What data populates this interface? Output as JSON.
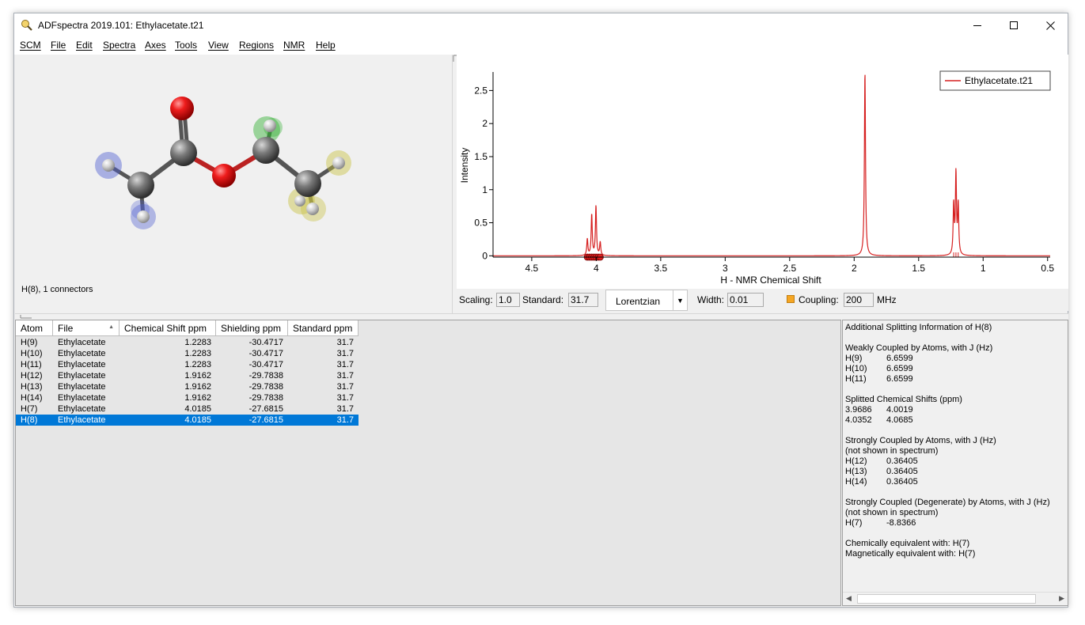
{
  "window": {
    "title": "ADFspectra 2019.101: Ethylacetate.t21"
  },
  "menu": [
    "SCM",
    "File",
    "Edit",
    "Spectra",
    "Axes",
    "Tools",
    "View",
    "Regions",
    "NMR",
    "Help"
  ],
  "molecule": {
    "status": "H(8), 1 connectors"
  },
  "spectrum": {
    "xlabel": "H - NMR Chemical Shift",
    "ylabel": "Intensity",
    "legend": "Ethylacetate.t21",
    "xticks": [
      "4.5",
      "4",
      "3.5",
      "3",
      "2.5",
      "2",
      "1.5",
      "1",
      "0.5"
    ],
    "yticks": [
      "0",
      "0.5",
      "1",
      "1.5",
      "2",
      "2.5"
    ]
  },
  "chart_data": {
    "type": "line",
    "xlabel": "H - NMR Chemical Shift",
    "ylabel": "Intensity",
    "xlim": [
      4.8,
      0.48
    ],
    "ylim": [
      -0.02,
      2.78
    ],
    "x_reversed": true,
    "series": [
      {
        "name": "Ethylacetate.t21",
        "color": "#d62020"
      }
    ],
    "peaks": [
      {
        "x": 4.069,
        "height": 0.25
      },
      {
        "x": 4.035,
        "height": 0.62
      },
      {
        "x": 4.002,
        "height": 0.75
      },
      {
        "x": 3.969,
        "height": 0.2
      },
      {
        "x": 1.9162,
        "height": 2.78
      },
      {
        "x": 1.2283,
        "height": 0.75
      },
      {
        "x": 1.2107,
        "height": 1.22
      },
      {
        "x": 1.1931,
        "height": 0.75
      }
    ],
    "linewidth": 0.01,
    "markers_x": [
      4.069,
      4.052,
      4.035,
      4.018,
      4.002,
      3.985,
      3.969
    ],
    "sticks_x": [
      1.2283,
      1.2107,
      1.1931
    ]
  },
  "toolbar": {
    "scaling_label": "Scaling:",
    "scaling_value": "1.0",
    "standard_label": "Standard:",
    "standard_value": "31.7",
    "lineshape": "Lorentzian",
    "width_label": "Width:",
    "width_value": "0.01",
    "coupling_label": "Coupling:",
    "coupling_value": "200",
    "unit": "MHz"
  },
  "table": {
    "columns": [
      "Atom",
      "File",
      "Chemical Shift ppm",
      "Shielding ppm",
      "Standard ppm"
    ],
    "rows": [
      [
        "H(9)",
        "Ethylacetate",
        "1.2283",
        "-30.4717",
        "31.7"
      ],
      [
        "H(10)",
        "Ethylacetate",
        "1.2283",
        "-30.4717",
        "31.7"
      ],
      [
        "H(11)",
        "Ethylacetate",
        "1.2283",
        "-30.4717",
        "31.7"
      ],
      [
        "H(12)",
        "Ethylacetate",
        "1.9162",
        "-29.7838",
        "31.7"
      ],
      [
        "H(13)",
        "Ethylacetate",
        "1.9162",
        "-29.7838",
        "31.7"
      ],
      [
        "H(14)",
        "Ethylacetate",
        "1.9162",
        "-29.7838",
        "31.7"
      ],
      [
        "H(7)",
        "Ethylacetate",
        "4.0185",
        "-27.6815",
        "31.7"
      ],
      [
        "H(8)",
        "Ethylacetate",
        "4.0185",
        "-27.6815",
        "31.7"
      ]
    ],
    "selected_row": 7
  },
  "info": {
    "lines": [
      [
        "Additional Splitting Information of H(8)",
        ""
      ],
      [
        "",
        ""
      ],
      [
        "Weakly Coupled by Atoms, with J (Hz)",
        ""
      ],
      [
        "H(9)",
        "6.6599"
      ],
      [
        "H(10)",
        "6.6599"
      ],
      [
        "H(11)",
        "6.6599"
      ],
      [
        "",
        ""
      ],
      [
        "Splitted Chemical Shifts (ppm)",
        ""
      ],
      [
        "3.9686",
        "4.0019"
      ],
      [
        "4.0352",
        "4.0685"
      ],
      [
        "",
        ""
      ],
      [
        "Strongly Coupled by Atoms, with J (Hz)",
        ""
      ],
      [
        "(not shown in spectrum)",
        ""
      ],
      [
        "H(12)",
        "0.36405"
      ],
      [
        "H(13)",
        "0.36405"
      ],
      [
        "H(14)",
        "0.36405"
      ],
      [
        "",
        ""
      ],
      [
        "Strongly Coupled (Degenerate) by Atoms, with J (Hz)",
        ""
      ],
      [
        "(not shown in spectrum)",
        ""
      ],
      [
        "H(7)",
        "-8.8366"
      ],
      [
        "",
        ""
      ],
      [
        "Chemically equivalent with: H(7)",
        ""
      ],
      [
        "Magnetically equivalent with: H(7)",
        ""
      ]
    ]
  }
}
